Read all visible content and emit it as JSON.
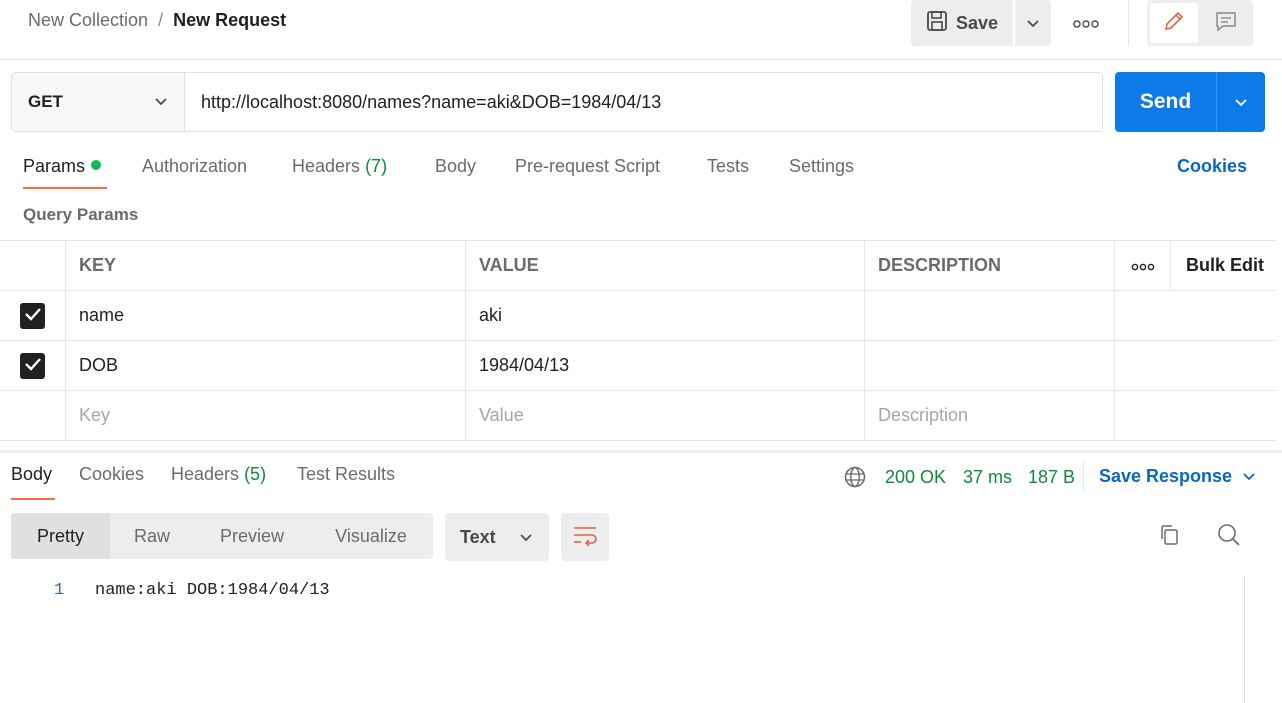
{
  "breadcrumb": {
    "parent": "New Collection",
    "separator": "/",
    "current": "New Request"
  },
  "toolbar": {
    "save_label": "Save"
  },
  "request": {
    "method": "GET",
    "url": "http://localhost:8080/names?name=aki&DOB=1984/04/13",
    "send_label": "Send"
  },
  "request_tabs": {
    "params": "Params",
    "authorization": "Authorization",
    "headers": "Headers",
    "headers_count": "(7)",
    "body": "Body",
    "prerequest": "Pre-request Script",
    "tests": "Tests",
    "settings": "Settings",
    "cookies": "Cookies"
  },
  "query_params": {
    "title": "Query Params",
    "columns": {
      "key": "KEY",
      "value": "VALUE",
      "description": "DESCRIPTION",
      "bulk_edit": "Bulk Edit"
    },
    "rows": [
      {
        "checked": true,
        "key": "name",
        "value": "aki",
        "description": ""
      },
      {
        "checked": true,
        "key": "DOB",
        "value": "1984/04/13",
        "description": ""
      }
    ],
    "placeholders": {
      "key": "Key",
      "value": "Value",
      "description": "Description"
    }
  },
  "response_tabs": {
    "body": "Body",
    "cookies": "Cookies",
    "headers": "Headers",
    "headers_count": "(5)",
    "test_results": "Test Results"
  },
  "response_meta": {
    "status": "200 OK",
    "time": "37 ms",
    "size": "187 B",
    "save_response": "Save Response"
  },
  "response_view": {
    "modes": [
      "Pretty",
      "Raw",
      "Preview",
      "Visualize"
    ],
    "active_mode": "Pretty",
    "format": "Text",
    "lines": [
      {
        "number": "1",
        "text": "name:aki DOB:1984/04/13"
      }
    ]
  },
  "colors": {
    "accent_orange": "#ff6c37",
    "send_blue": "#0c7ae8",
    "link_blue": "#0a67c4",
    "status_green": "#0f8a3a"
  }
}
